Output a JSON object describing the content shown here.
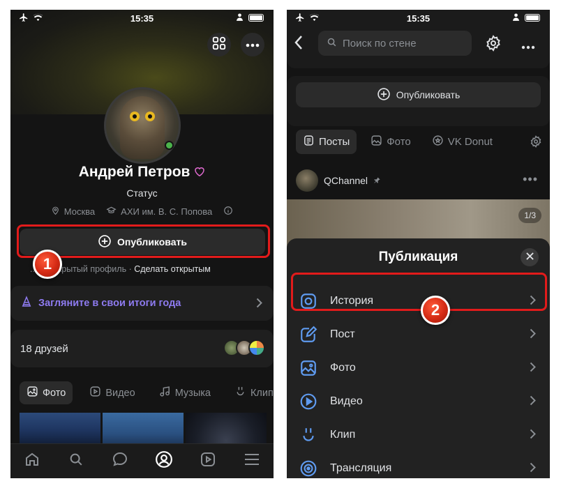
{
  "status_bar_left": {
    "time": "15:35"
  },
  "status_bar_right": {
    "time": "15:35"
  },
  "profile": {
    "name": "Андрей Петров",
    "status": "Статус",
    "city": "Москва",
    "university": "АХИ им. В. С. Попова",
    "publish_label": "Опубликовать",
    "closed_profile_text": "...ас закрытый профиль",
    "make_open_label": "Сделать открытым",
    "year_results": "Загляните в свои итоги года",
    "friends_count": "18 друзей",
    "media_tabs": [
      "Фото",
      "Видео",
      "Музыка",
      "Клип"
    ]
  },
  "wall": {
    "search_placeholder": "Поиск по стене",
    "publish_label": "Опубликовать",
    "tabs": [
      "Посты",
      "Фото",
      "VK Donut"
    ],
    "post_author": "QChannel",
    "photo_counter": "1/3"
  },
  "publication_sheet": {
    "title": "Публикация",
    "items": [
      "История",
      "Пост",
      "Фото",
      "Видео",
      "Клип",
      "Трансляция"
    ]
  },
  "callouts": {
    "first": "1",
    "second": "2"
  },
  "colors": {
    "accent_purple": "#8e7bf0",
    "online": "#4bb34b",
    "highlight": "#e21b1b",
    "icon_blue": "#5f9bf0"
  }
}
